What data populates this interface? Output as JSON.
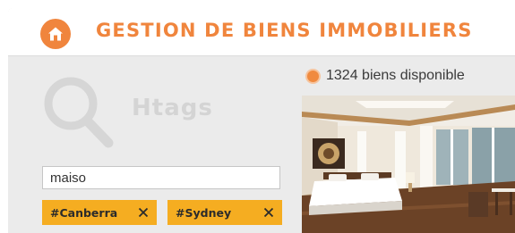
{
  "header": {
    "title": "GESTION DE BIENS IMMOBILIERS",
    "home_icon": "home-icon",
    "accent": "#f0853d"
  },
  "search": {
    "logo_text": "Htags",
    "logo_icon": "magnifier-icon",
    "value": "maiso"
  },
  "tags": [
    {
      "label": "#Canberra",
      "remove_icon": "close-icon"
    },
    {
      "label": "#Sydney",
      "remove_icon": "close-icon"
    }
  ],
  "tag_color": "#f5ad21",
  "results": {
    "count_text": "1324 biens disponible",
    "indicator_color": "#f08a3f"
  },
  "listing": {
    "image": "property-bedroom-photo"
  }
}
